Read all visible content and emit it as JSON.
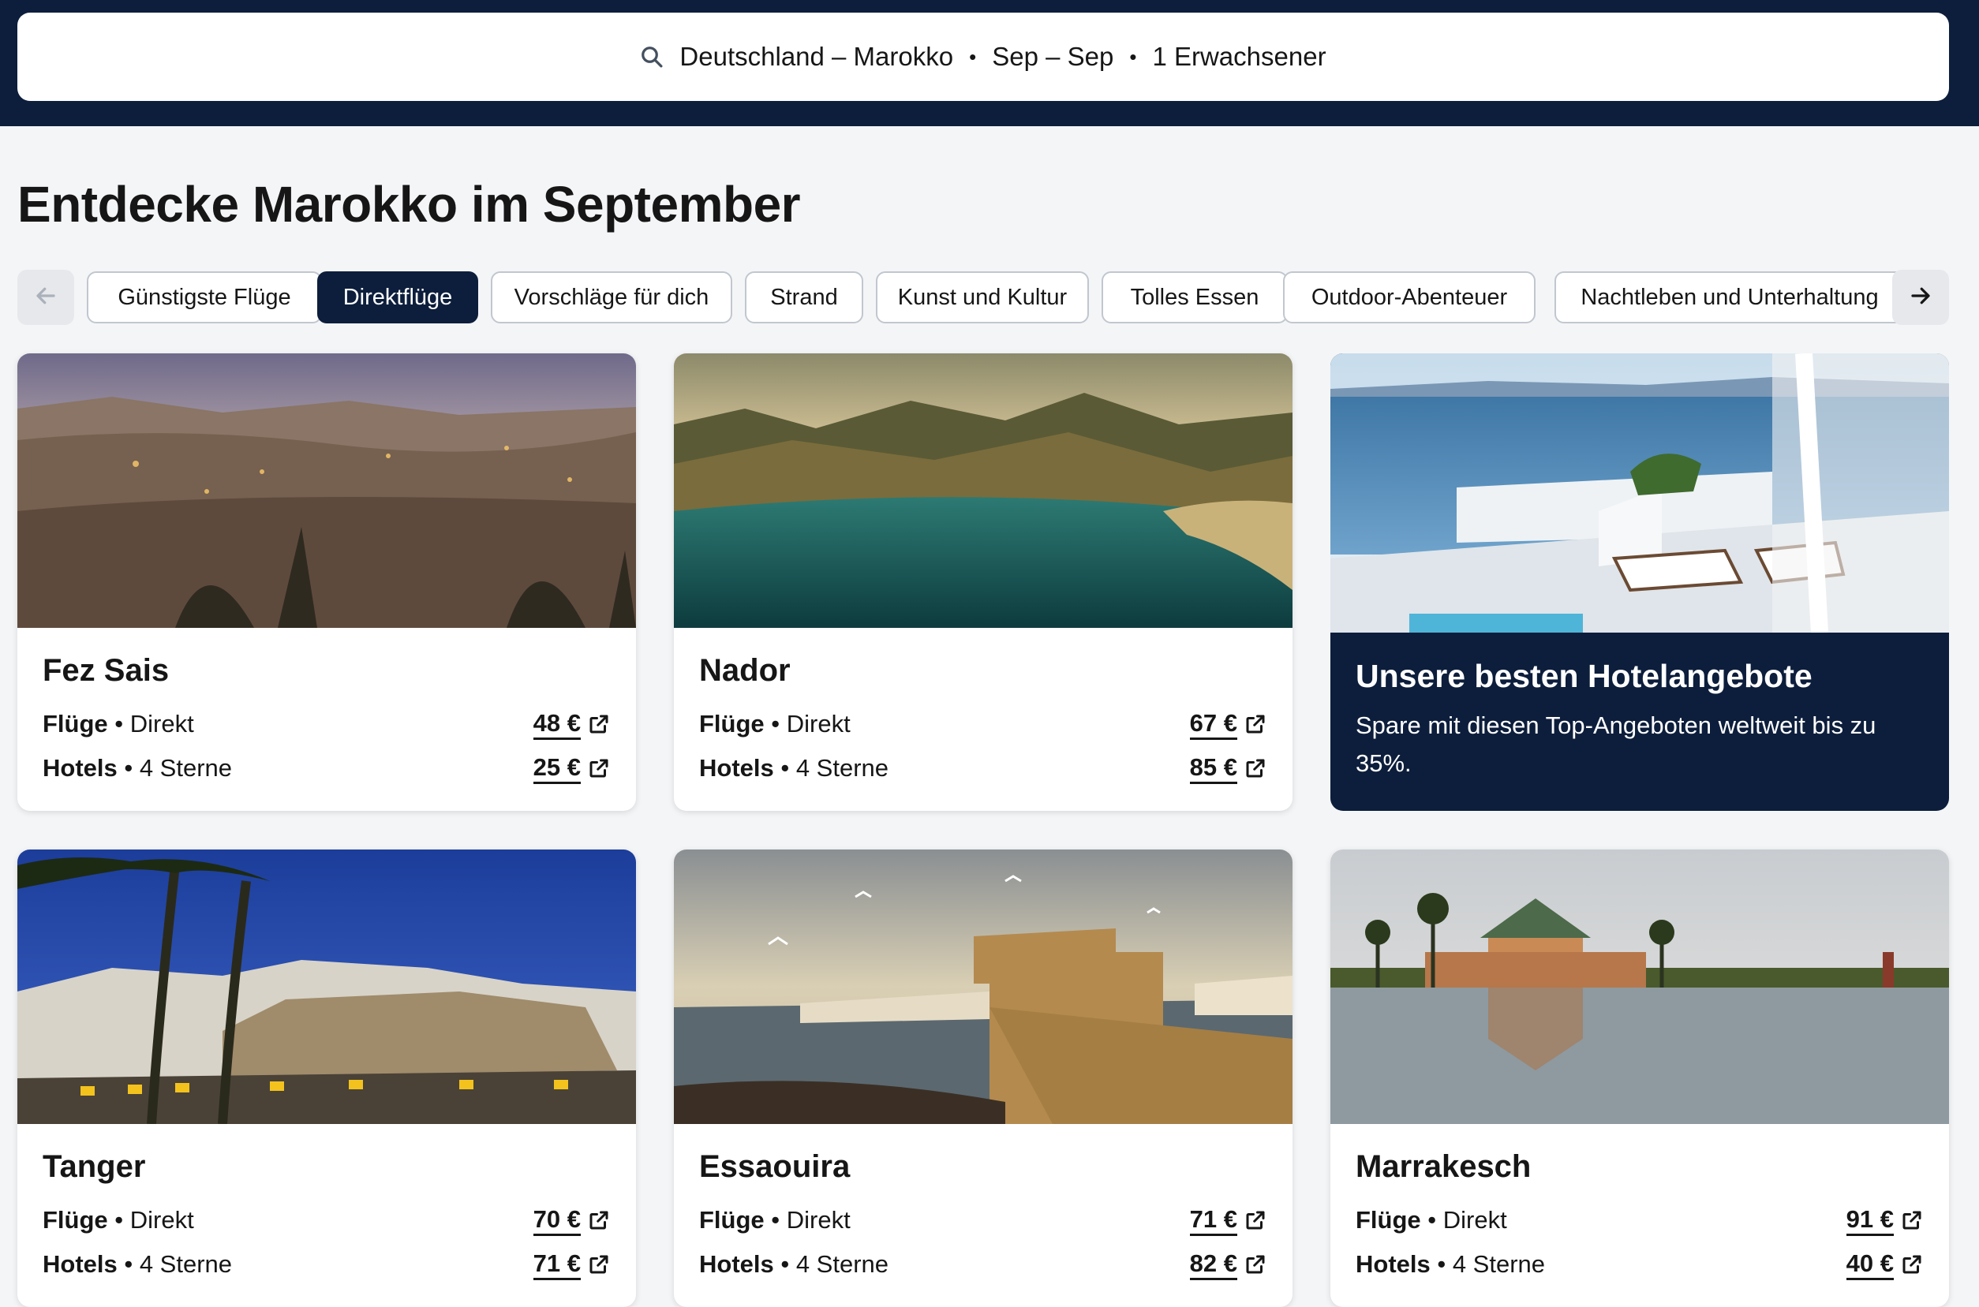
{
  "search": {
    "route": "Deutschland – Marokko",
    "dates": "Sep – Sep",
    "travelers": "1 Erwachsener",
    "separator": "•"
  },
  "page_title": "Entdecke Marokko im September",
  "filters": [
    {
      "label": "Günstigste Flüge",
      "active": false
    },
    {
      "label": "Direktflüge",
      "active": true
    },
    {
      "label": "Vorschläge für dich",
      "active": false
    },
    {
      "label": "Strand",
      "active": false
    },
    {
      "label": "Kunst und Kultur",
      "active": false
    },
    {
      "label": "Tolles Essen",
      "active": false
    },
    {
      "label": "Outdoor-Abenteuer",
      "active": false
    },
    {
      "label": "Nachtleben und Unterhaltung",
      "active": false
    }
  ],
  "labels": {
    "flights": "Flüge",
    "flights_detail": " • Direkt",
    "hotels": "Hotels",
    "hotels_detail": " • 4 Sterne"
  },
  "cards": [
    {
      "city": "Fez Sais",
      "flight_price": "48 €",
      "hotel_price": "25 €"
    },
    {
      "city": "Nador",
      "flight_price": "67 €",
      "hotel_price": "85 €"
    },
    {
      "city": "Tanger",
      "flight_price": "70 €",
      "hotel_price": "71 €"
    },
    {
      "city": "Essaouira",
      "flight_price": "71 €",
      "hotel_price": "82 €"
    },
    {
      "city": "Marrakesch",
      "flight_price": "91 €",
      "hotel_price": "40 €"
    }
  ],
  "promo": {
    "title": "Unsere besten Hotelangebote",
    "text": "Spare mit diesen Top-Angeboten weltweit bis zu 35%."
  },
  "colors": {
    "brand_navy": "#0d1e3c",
    "page_bg": "#f4f5f7",
    "chip_border": "#c1c7cf"
  }
}
